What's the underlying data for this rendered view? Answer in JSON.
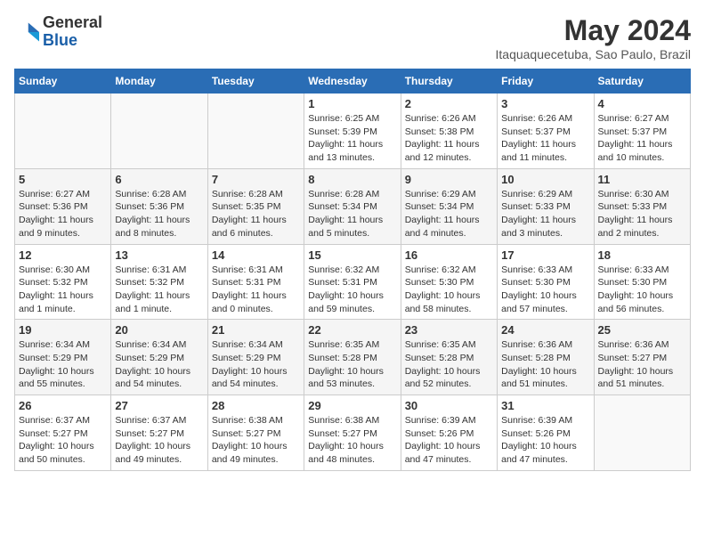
{
  "header": {
    "logo_line1": "General",
    "logo_line2": "Blue",
    "month_year": "May 2024",
    "location": "Itaquaquecetuba, Sao Paulo, Brazil"
  },
  "days_of_week": [
    "Sunday",
    "Monday",
    "Tuesday",
    "Wednesday",
    "Thursday",
    "Friday",
    "Saturday"
  ],
  "weeks": [
    [
      {
        "day": "",
        "info": ""
      },
      {
        "day": "",
        "info": ""
      },
      {
        "day": "",
        "info": ""
      },
      {
        "day": "1",
        "info": "Sunrise: 6:25 AM\nSunset: 5:39 PM\nDaylight: 11 hours\nand 13 minutes."
      },
      {
        "day": "2",
        "info": "Sunrise: 6:26 AM\nSunset: 5:38 PM\nDaylight: 11 hours\nand 12 minutes."
      },
      {
        "day": "3",
        "info": "Sunrise: 6:26 AM\nSunset: 5:37 PM\nDaylight: 11 hours\nand 11 minutes."
      },
      {
        "day": "4",
        "info": "Sunrise: 6:27 AM\nSunset: 5:37 PM\nDaylight: 11 hours\nand 10 minutes."
      }
    ],
    [
      {
        "day": "5",
        "info": "Sunrise: 6:27 AM\nSunset: 5:36 PM\nDaylight: 11 hours\nand 9 minutes."
      },
      {
        "day": "6",
        "info": "Sunrise: 6:28 AM\nSunset: 5:36 PM\nDaylight: 11 hours\nand 8 minutes."
      },
      {
        "day": "7",
        "info": "Sunrise: 6:28 AM\nSunset: 5:35 PM\nDaylight: 11 hours\nand 6 minutes."
      },
      {
        "day": "8",
        "info": "Sunrise: 6:28 AM\nSunset: 5:34 PM\nDaylight: 11 hours\nand 5 minutes."
      },
      {
        "day": "9",
        "info": "Sunrise: 6:29 AM\nSunset: 5:34 PM\nDaylight: 11 hours\nand 4 minutes."
      },
      {
        "day": "10",
        "info": "Sunrise: 6:29 AM\nSunset: 5:33 PM\nDaylight: 11 hours\nand 3 minutes."
      },
      {
        "day": "11",
        "info": "Sunrise: 6:30 AM\nSunset: 5:33 PM\nDaylight: 11 hours\nand 2 minutes."
      }
    ],
    [
      {
        "day": "12",
        "info": "Sunrise: 6:30 AM\nSunset: 5:32 PM\nDaylight: 11 hours\nand 1 minute."
      },
      {
        "day": "13",
        "info": "Sunrise: 6:31 AM\nSunset: 5:32 PM\nDaylight: 11 hours\nand 1 minute."
      },
      {
        "day": "14",
        "info": "Sunrise: 6:31 AM\nSunset: 5:31 PM\nDaylight: 11 hours\nand 0 minutes."
      },
      {
        "day": "15",
        "info": "Sunrise: 6:32 AM\nSunset: 5:31 PM\nDaylight: 10 hours\nand 59 minutes."
      },
      {
        "day": "16",
        "info": "Sunrise: 6:32 AM\nSunset: 5:30 PM\nDaylight: 10 hours\nand 58 minutes."
      },
      {
        "day": "17",
        "info": "Sunrise: 6:33 AM\nSunset: 5:30 PM\nDaylight: 10 hours\nand 57 minutes."
      },
      {
        "day": "18",
        "info": "Sunrise: 6:33 AM\nSunset: 5:30 PM\nDaylight: 10 hours\nand 56 minutes."
      }
    ],
    [
      {
        "day": "19",
        "info": "Sunrise: 6:34 AM\nSunset: 5:29 PM\nDaylight: 10 hours\nand 55 minutes."
      },
      {
        "day": "20",
        "info": "Sunrise: 6:34 AM\nSunset: 5:29 PM\nDaylight: 10 hours\nand 54 minutes."
      },
      {
        "day": "21",
        "info": "Sunrise: 6:34 AM\nSunset: 5:29 PM\nDaylight: 10 hours\nand 54 minutes."
      },
      {
        "day": "22",
        "info": "Sunrise: 6:35 AM\nSunset: 5:28 PM\nDaylight: 10 hours\nand 53 minutes."
      },
      {
        "day": "23",
        "info": "Sunrise: 6:35 AM\nSunset: 5:28 PM\nDaylight: 10 hours\nand 52 minutes."
      },
      {
        "day": "24",
        "info": "Sunrise: 6:36 AM\nSunset: 5:28 PM\nDaylight: 10 hours\nand 51 minutes."
      },
      {
        "day": "25",
        "info": "Sunrise: 6:36 AM\nSunset: 5:27 PM\nDaylight: 10 hours\nand 51 minutes."
      }
    ],
    [
      {
        "day": "26",
        "info": "Sunrise: 6:37 AM\nSunset: 5:27 PM\nDaylight: 10 hours\nand 50 minutes."
      },
      {
        "day": "27",
        "info": "Sunrise: 6:37 AM\nSunset: 5:27 PM\nDaylight: 10 hours\nand 49 minutes."
      },
      {
        "day": "28",
        "info": "Sunrise: 6:38 AM\nSunset: 5:27 PM\nDaylight: 10 hours\nand 49 minutes."
      },
      {
        "day": "29",
        "info": "Sunrise: 6:38 AM\nSunset: 5:27 PM\nDaylight: 10 hours\nand 48 minutes."
      },
      {
        "day": "30",
        "info": "Sunrise: 6:39 AM\nSunset: 5:26 PM\nDaylight: 10 hours\nand 47 minutes."
      },
      {
        "day": "31",
        "info": "Sunrise: 6:39 AM\nSunset: 5:26 PM\nDaylight: 10 hours\nand 47 minutes."
      },
      {
        "day": "",
        "info": ""
      }
    ]
  ]
}
